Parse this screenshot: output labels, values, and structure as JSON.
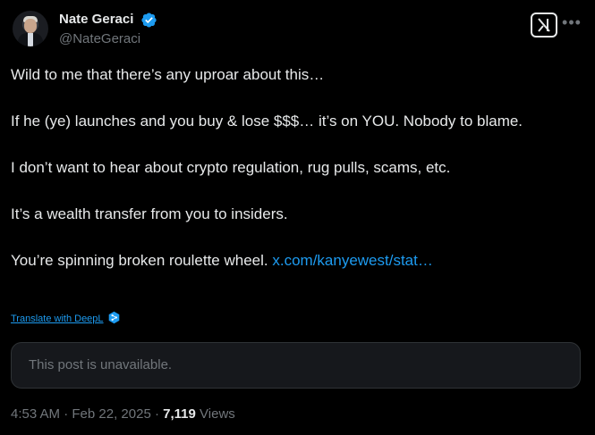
{
  "author": {
    "name": "Nate Geraci",
    "handle": "@NateGeraci",
    "verified": true,
    "verified_color": "#1d9bf0"
  },
  "icons": {
    "grok": "grok-icon",
    "more": "more-icon",
    "verified": "verified-badge-icon",
    "translate": "deepl-icon"
  },
  "tweet": {
    "paragraphs": [
      "Wild to me that there’s any uproar about this…",
      "If he (ye) launches and you buy & lose $$$… it’s on YOU. Nobody to blame.",
      "I don’t want to hear about crypto regulation, rug pulls, scams, etc.",
      "It’s a wealth transfer from you to insiders."
    ],
    "last_paragraph_text": "You’re spinning broken roulette wheel.",
    "link_text": "x.com/kanyewest/stat…"
  },
  "translate_label": "Translate with DeepL",
  "quoted_post": {
    "message": "This post is unavailable."
  },
  "meta": {
    "time": "4:53 AM",
    "separator": "·",
    "date": "Feb 22, 2025",
    "views_count": "7,119",
    "views_label": "Views"
  },
  "colors": {
    "background": "#000000",
    "text": "#e7e9ea",
    "secondary": "#71767b",
    "link": "#1d9bf0",
    "card_bg": "#16181c",
    "card_border": "#2f3336"
  }
}
